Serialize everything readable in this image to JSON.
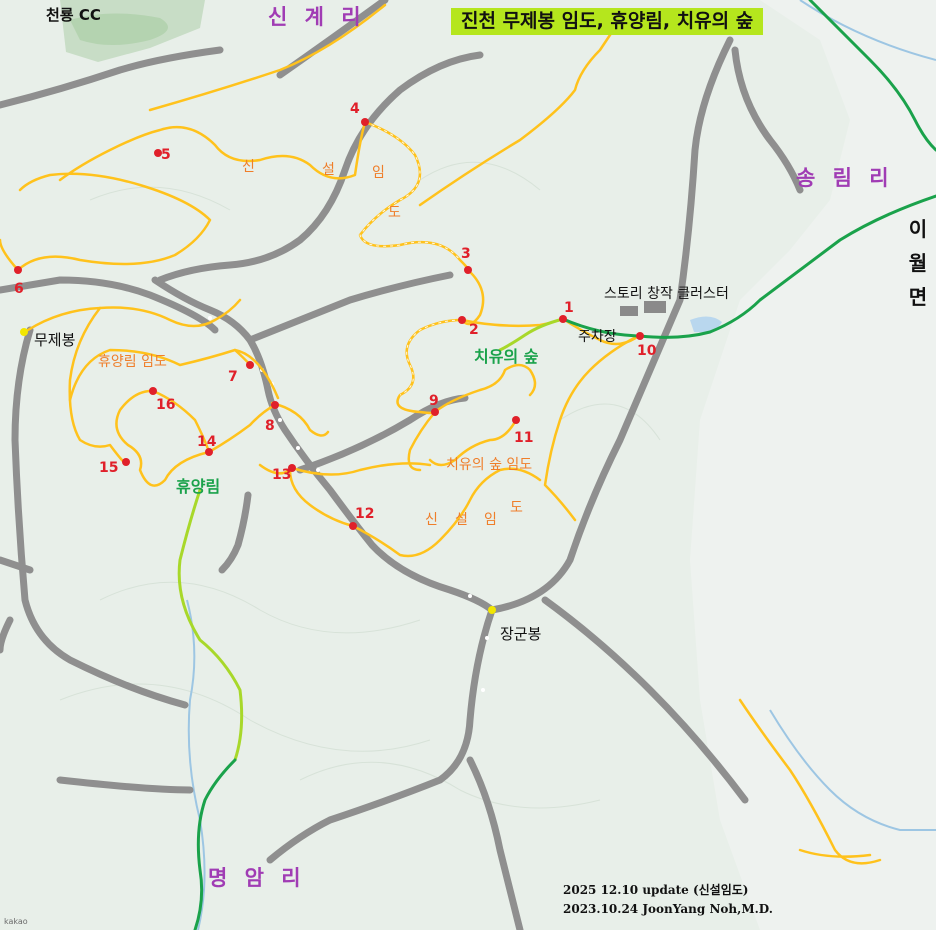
{
  "title": "진천 무제봉 임도, 휴양림, 치유의 숲",
  "places": {
    "golf": "천룡 CC",
    "singye": "신 계 리",
    "songnim": "송 림 리",
    "myeongam": "명 암 리",
    "iwol": [
      "이",
      "월",
      "면"
    ],
    "mujebong": "무제봉",
    "janggunbong": "장군봉",
    "parking": "주차장",
    "story_cluster": "스토리 창작 클러스터"
  },
  "routes": {
    "sinseol_chars": [
      "신",
      "설",
      "임",
      "도"
    ],
    "hyuyang_imdo": "휴양림 임도",
    "hyuyangnim": "휴양림",
    "chiyu": "치유의 숲",
    "chiyu_imdo": "치유의 숲 임도",
    "sinseol2_chars": [
      "신",
      "설",
      "임",
      "도"
    ]
  },
  "waypoints": [
    "1",
    "2",
    "3",
    "4",
    "5",
    "6",
    "7",
    "8",
    "9",
    "10",
    "11",
    "12",
    "13",
    "14",
    "15",
    "16"
  ],
  "credits": {
    "update": "2025 12.10 update (신설임도)",
    "author": "2023.10.24 JoonYang Noh,M.D."
  },
  "attribution": "kakao",
  "colors": {
    "background": "#e8efe9",
    "main_road": "#8f8f8f",
    "trail": "#ffc21c",
    "new_trail": "#ffd54a",
    "green_route": "#1aa24b",
    "lime_route": "#a8d82a",
    "waypoint": "#e0202a",
    "summit": "#f2e600",
    "title_bg": "#b5e61d",
    "village_text": "#a03cb4"
  }
}
